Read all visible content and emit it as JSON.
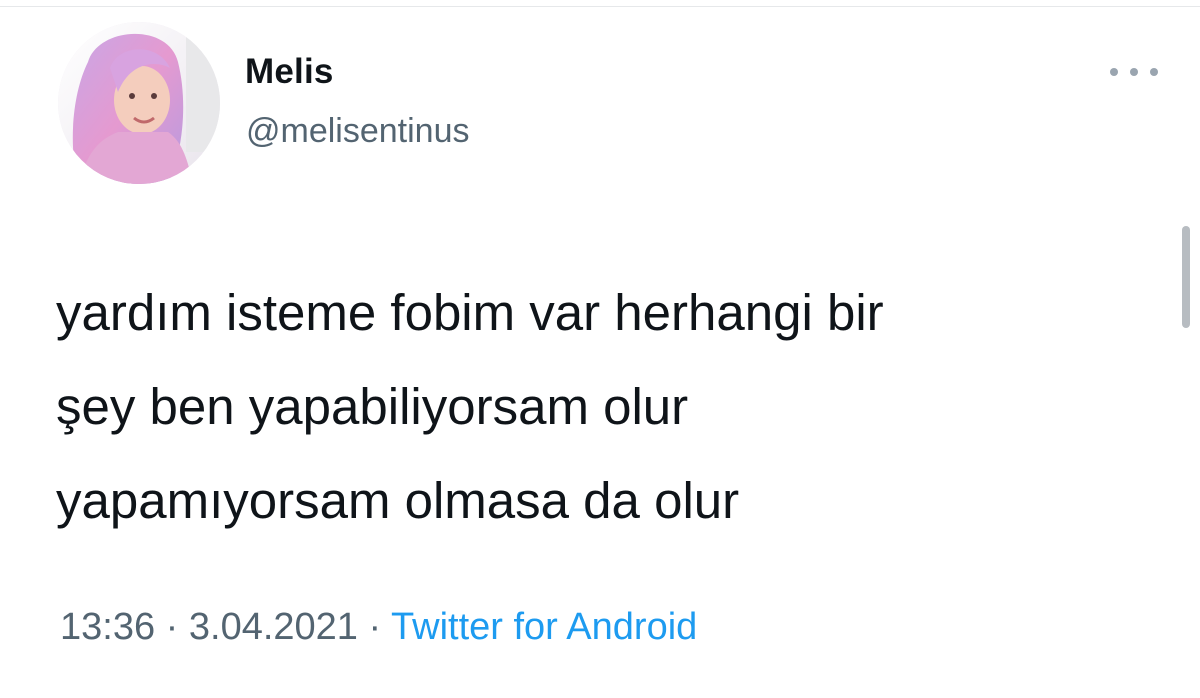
{
  "tweet": {
    "author": {
      "display_name": "Melis",
      "handle": "@melisentinus",
      "avatar_icon": "profile-photo"
    },
    "more_icon": "more-horizontal-icon",
    "text_lines": [
      "yardım isteme fobim var herhangi bir",
      "şey ben yapabiliyorsam olur",
      "yapamıyorsam olmasa da olur"
    ],
    "time": "13:36",
    "separator": "·",
    "date": "3.04.2021",
    "source": "Twitter for Android"
  },
  "colors": {
    "text": "#0f1419",
    "secondary": "#536471",
    "link": "#1d9bf0"
  }
}
